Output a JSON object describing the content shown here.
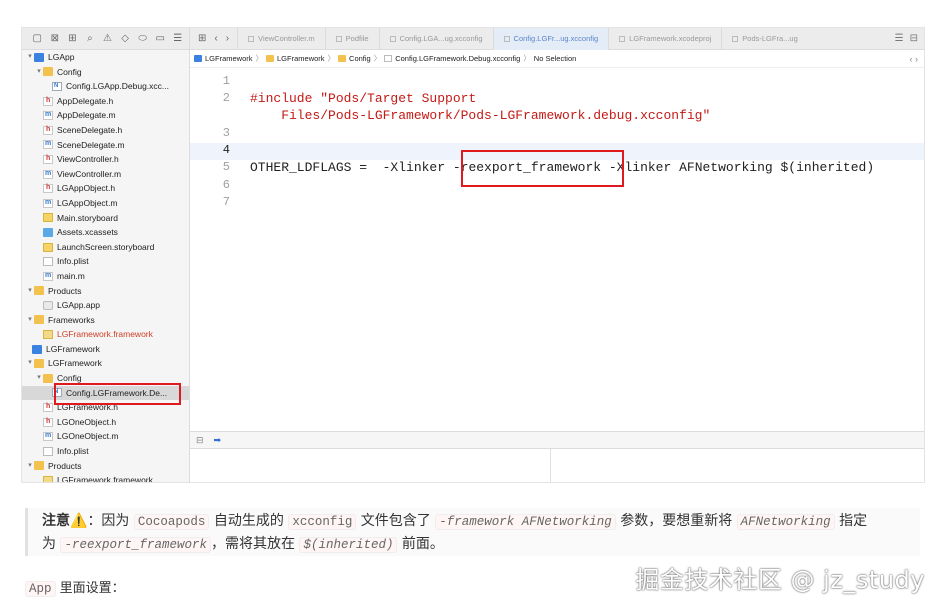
{
  "navigator": {
    "toolbar_icons": [
      "folder-icon",
      "x-square-icon",
      "hierarchy-icon",
      "search-icon",
      "warning-icon",
      "diamond-icon",
      "tag-icon",
      "comment-icon",
      "list-icon"
    ],
    "items": [
      {
        "label": "LGApp",
        "type": "proj",
        "indent": 0,
        "chev": "▾"
      },
      {
        "label": "Config",
        "type": "folder",
        "indent": 1,
        "chev": "▾"
      },
      {
        "label": "Config.LGApp.Debug.xcc...",
        "type": "cfg",
        "indent": 2,
        "chev": ""
      },
      {
        "label": "AppDelegate.h",
        "type": "h",
        "indent": 1,
        "chev": ""
      },
      {
        "label": "AppDelegate.m",
        "type": "m",
        "indent": 1,
        "chev": ""
      },
      {
        "label": "SceneDelegate.h",
        "type": "h",
        "indent": 1,
        "chev": ""
      },
      {
        "label": "SceneDelegate.m",
        "type": "m",
        "indent": 1,
        "chev": ""
      },
      {
        "label": "ViewController.h",
        "type": "h",
        "indent": 1,
        "chev": ""
      },
      {
        "label": "ViewController.m",
        "type": "m",
        "indent": 1,
        "chev": ""
      },
      {
        "label": "LGAppObject.h",
        "type": "h",
        "indent": 1,
        "chev": ""
      },
      {
        "label": "LGAppObject.m",
        "type": "m",
        "indent": 1,
        "chev": ""
      },
      {
        "label": "Main.storyboard",
        "type": "sb",
        "indent": 1,
        "chev": ""
      },
      {
        "label": "Assets.xcassets",
        "type": "assets",
        "indent": 1,
        "chev": ""
      },
      {
        "label": "LaunchScreen.storyboard",
        "type": "sb",
        "indent": 1,
        "chev": ""
      },
      {
        "label": "Info.plist",
        "type": "doc",
        "indent": 1,
        "chev": ""
      },
      {
        "label": "main.m",
        "type": "m",
        "indent": 1,
        "chev": ""
      },
      {
        "label": "Products",
        "type": "folder",
        "indent": 0,
        "chev": "▾"
      },
      {
        "label": "LGApp.app",
        "type": "app",
        "indent": 1,
        "chev": ""
      },
      {
        "label": "Frameworks",
        "type": "folder",
        "indent": 0,
        "chev": "▾"
      },
      {
        "label": "LGFramework.framework",
        "type": "fw",
        "indent": 1,
        "chev": "",
        "red": true
      },
      {
        "label": "LGFramework",
        "type": "proj",
        "indent": -1,
        "chev": ""
      },
      {
        "label": "LGFramework",
        "type": "folder",
        "indent": 0,
        "chev": "▾"
      },
      {
        "label": "Config",
        "type": "folder",
        "indent": 1,
        "chev": "▾"
      },
      {
        "label": "Config.LGFramework.De...",
        "type": "cfg",
        "indent": 2,
        "chev": "",
        "selected": true
      },
      {
        "label": "LGFramework.h",
        "type": "h",
        "indent": 1,
        "chev": ""
      },
      {
        "label": "LGOneObject.h",
        "type": "h",
        "indent": 1,
        "chev": ""
      },
      {
        "label": "LGOneObject.m",
        "type": "m",
        "indent": 1,
        "chev": ""
      },
      {
        "label": "Info.plist",
        "type": "doc",
        "indent": 1,
        "chev": ""
      },
      {
        "label": "Products",
        "type": "folder",
        "indent": 0,
        "chev": "▾"
      },
      {
        "label": "LGFramework.framework",
        "type": "fw",
        "indent": 1,
        "chev": ""
      }
    ]
  },
  "tabs": [
    {
      "label": "ViewController.m",
      "active": false
    },
    {
      "label": "Podfile",
      "active": false
    },
    {
      "label": "Config.LGA...ug.xcconfig",
      "active": false
    },
    {
      "label": "Config.LGFr...ug.xcconfig",
      "active": true
    },
    {
      "label": "LGFramework.xcodeproj",
      "active": false
    },
    {
      "label": "Pods-LGFra...ug",
      "active": false
    }
  ],
  "breadcrumb": [
    "LGFramework",
    "LGFramework",
    "Config",
    "Config.LGFramework.Debug.xcconfig",
    "No Selection"
  ],
  "code": {
    "line_numbers": [
      "1",
      "2",
      "3",
      "4",
      "5",
      "6",
      "7"
    ],
    "include_kw": "#include ",
    "include_path_1": "\"Pods/Target Support",
    "include_path_2": "    Files/Pods-LGFramework/Pods-LGFramework.debug.xcconfig\"",
    "flags_prefix": "OTHER_LDFLAGS =  -Xlinker ",
    "flags_highlight": "-reexport_framework",
    "flags_suffix": " -Xlinker AFNetworking $(inherited)"
  },
  "note": {
    "p1": "注意",
    "p2": "：因为 ",
    "c1": "Cocoapods",
    "p3": " 自动生成的 ",
    "c2": "xcconfig",
    "p4": " 文件包含了 ",
    "c3": "-framework AFNetworking",
    "p5": " 参数，要想重新将 ",
    "c4": "AFNetworking",
    "p6": " 指定",
    "p7": "为 ",
    "c5": "-reexport_framework",
    "p8": "，需将其放在 ",
    "c6": "$(inherited)",
    "p9": " 前面。"
  },
  "app_label": {
    "code": "App",
    "text": " 里面设置："
  },
  "watermark": "掘金技术社区 @ jz_study"
}
